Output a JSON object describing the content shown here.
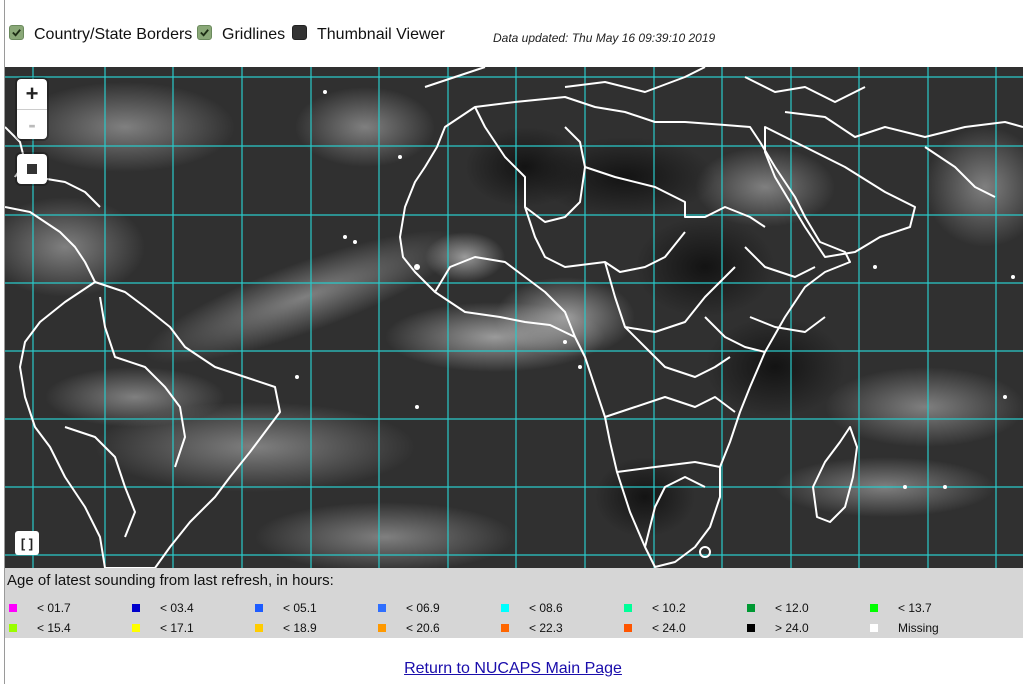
{
  "toolbar": {
    "borders_label": "Country/State Borders",
    "gridlines_label": "Gridlines",
    "thumbnail_label": "Thumbnail Viewer",
    "updated_text": "Data updated: Thu May 16 09:39:10 2019"
  },
  "map_controls": {
    "zoom_in": "+",
    "zoom_out": "-",
    "fullscreen": "[ ]"
  },
  "legend": {
    "title": "Age of latest sounding from last refresh, in hours:",
    "items": [
      {
        "label": "< 01.7",
        "color": "#ff00ff"
      },
      {
        "label": "< 03.4",
        "color": "#0000cc"
      },
      {
        "label": "< 05.1",
        "color": "#1e5cff"
      },
      {
        "label": "< 06.9",
        "color": "#2f6fff"
      },
      {
        "label": "< 08.6",
        "color": "#00ffff"
      },
      {
        "label": "< 10.2",
        "color": "#00ff99"
      },
      {
        "label": "< 12.0",
        "color": "#009933"
      },
      {
        "label": "< 13.7",
        "color": "#00ff00"
      },
      {
        "label": "< 15.4",
        "color": "#99ff00"
      },
      {
        "label": "< 17.1",
        "color": "#ffff00"
      },
      {
        "label": "< 18.9",
        "color": "#ffcc00"
      },
      {
        "label": "< 20.6",
        "color": "#ff9900"
      },
      {
        "label": "< 22.3",
        "color": "#ff6600"
      },
      {
        "label": "< 24.0",
        "color": "#ff5500"
      },
      {
        "label": "> 24.0",
        "color": "#000000"
      },
      {
        "label": "Missing",
        "color": "#ffffff"
      }
    ]
  },
  "footer": {
    "return_link": "Return to NUCAPS Main Page"
  }
}
